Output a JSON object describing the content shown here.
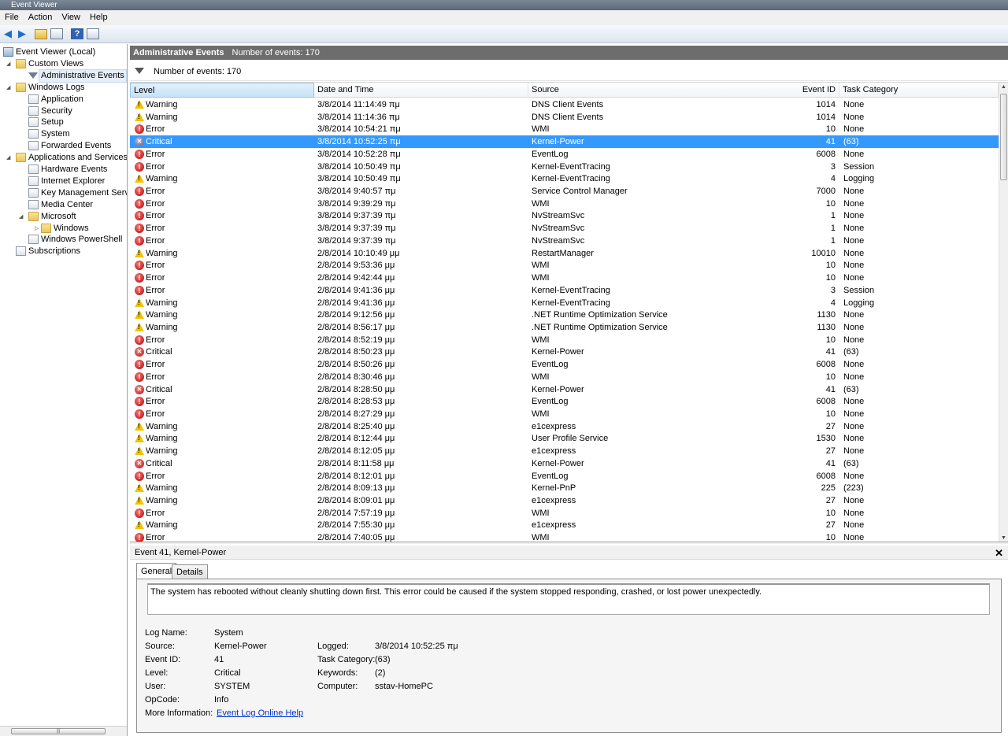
{
  "window": {
    "title": "Event Viewer"
  },
  "menu": [
    "File",
    "Action",
    "View",
    "Help"
  ],
  "tree": [
    {
      "label": "Event Viewer (Local)",
      "depth": 0,
      "icon": "computer-icon",
      "expander": ""
    },
    {
      "label": "Custom Views",
      "depth": 1,
      "icon": "folder-icon",
      "expander": "◢"
    },
    {
      "label": "Administrative Events",
      "depth": 2,
      "icon": "filter-icon",
      "expander": "",
      "selected": true
    },
    {
      "label": "Windows Logs",
      "depth": 1,
      "icon": "folder-icon",
      "expander": "◢"
    },
    {
      "label": "Application",
      "depth": 2,
      "icon": "log-icon",
      "expander": ""
    },
    {
      "label": "Security",
      "depth": 2,
      "icon": "log-icon",
      "expander": ""
    },
    {
      "label": "Setup",
      "depth": 2,
      "icon": "log-icon",
      "expander": ""
    },
    {
      "label": "System",
      "depth": 2,
      "icon": "log-icon",
      "expander": ""
    },
    {
      "label": "Forwarded Events",
      "depth": 2,
      "icon": "log-icon",
      "expander": ""
    },
    {
      "label": "Applications and Services Lo",
      "depth": 1,
      "icon": "folder-icon",
      "expander": "◢"
    },
    {
      "label": "Hardware Events",
      "depth": 2,
      "icon": "log-icon",
      "expander": ""
    },
    {
      "label": "Internet Explorer",
      "depth": 2,
      "icon": "log-icon",
      "expander": ""
    },
    {
      "label": "Key Management Service",
      "depth": 2,
      "icon": "log-icon",
      "expander": ""
    },
    {
      "label": "Media Center",
      "depth": 2,
      "icon": "log-icon",
      "expander": ""
    },
    {
      "label": "Microsoft",
      "depth": 2,
      "icon": "folder-icon",
      "expander": "◢"
    },
    {
      "label": "Windows",
      "depth": 3,
      "icon": "folder-icon",
      "expander": "▷"
    },
    {
      "label": "Windows PowerShell",
      "depth": 2,
      "icon": "log-icon",
      "expander": ""
    },
    {
      "label": "Subscriptions",
      "depth": 1,
      "icon": "log-icon",
      "expander": ""
    }
  ],
  "header": {
    "title": "Administrative Events",
    "count": "Number of events: 170"
  },
  "filter": {
    "text": "Number of events: 170"
  },
  "columns": [
    "Level",
    "Date and Time",
    "Source",
    "Event ID",
    "Task Category"
  ],
  "events": [
    {
      "level": "Warning",
      "date": "3/8/2014 11:14:49 πμ",
      "source": "DNS Client Events",
      "id": "1014",
      "task": "None"
    },
    {
      "level": "Warning",
      "date": "3/8/2014 11:14:36 πμ",
      "source": "DNS Client Events",
      "id": "1014",
      "task": "None"
    },
    {
      "level": "Error",
      "date": "3/8/2014 10:54:21 πμ",
      "source": "WMI",
      "id": "10",
      "task": "None"
    },
    {
      "level": "Critical",
      "date": "3/8/2014 10:52:25 πμ",
      "source": "Kernel-Power",
      "id": "41",
      "task": "(63)",
      "selected": true
    },
    {
      "level": "Error",
      "date": "3/8/2014 10:52:28 πμ",
      "source": "EventLog",
      "id": "6008",
      "task": "None"
    },
    {
      "level": "Error",
      "date": "3/8/2014 10:50:49 πμ",
      "source": "Kernel-EventTracing",
      "id": "3",
      "task": "Session"
    },
    {
      "level": "Warning",
      "date": "3/8/2014 10:50:49 πμ",
      "source": "Kernel-EventTracing",
      "id": "4",
      "task": "Logging"
    },
    {
      "level": "Error",
      "date": "3/8/2014 9:40:57 πμ",
      "source": "Service Control Manager",
      "id": "7000",
      "task": "None"
    },
    {
      "level": "Error",
      "date": "3/8/2014 9:39:29 πμ",
      "source": "WMI",
      "id": "10",
      "task": "None"
    },
    {
      "level": "Error",
      "date": "3/8/2014 9:37:39 πμ",
      "source": "NvStreamSvc",
      "id": "1",
      "task": "None"
    },
    {
      "level": "Error",
      "date": "3/8/2014 9:37:39 πμ",
      "source": "NvStreamSvc",
      "id": "1",
      "task": "None"
    },
    {
      "level": "Error",
      "date": "3/8/2014 9:37:39 πμ",
      "source": "NvStreamSvc",
      "id": "1",
      "task": "None"
    },
    {
      "level": "Warning",
      "date": "2/8/2014 10:10:49 μμ",
      "source": "RestartManager",
      "id": "10010",
      "task": "None"
    },
    {
      "level": "Error",
      "date": "2/8/2014 9:53:36 μμ",
      "source": "WMI",
      "id": "10",
      "task": "None"
    },
    {
      "level": "Error",
      "date": "2/8/2014 9:42:44 μμ",
      "source": "WMI",
      "id": "10",
      "task": "None"
    },
    {
      "level": "Error",
      "date": "2/8/2014 9:41:36 μμ",
      "source": "Kernel-EventTracing",
      "id": "3",
      "task": "Session"
    },
    {
      "level": "Warning",
      "date": "2/8/2014 9:41:36 μμ",
      "source": "Kernel-EventTracing",
      "id": "4",
      "task": "Logging"
    },
    {
      "level": "Warning",
      "date": "2/8/2014 9:12:56 μμ",
      "source": ".NET Runtime Optimization Service",
      "id": "1130",
      "task": "None"
    },
    {
      "level": "Warning",
      "date": "2/8/2014 8:56:17 μμ",
      "source": ".NET Runtime Optimization Service",
      "id": "1130",
      "task": "None"
    },
    {
      "level": "Error",
      "date": "2/8/2014 8:52:19 μμ",
      "source": "WMI",
      "id": "10",
      "task": "None"
    },
    {
      "level": "Critical",
      "date": "2/8/2014 8:50:23 μμ",
      "source": "Kernel-Power",
      "id": "41",
      "task": "(63)"
    },
    {
      "level": "Error",
      "date": "2/8/2014 8:50:26 μμ",
      "source": "EventLog",
      "id": "6008",
      "task": "None"
    },
    {
      "level": "Error",
      "date": "2/8/2014 8:30:46 μμ",
      "source": "WMI",
      "id": "10",
      "task": "None"
    },
    {
      "level": "Critical",
      "date": "2/8/2014 8:28:50 μμ",
      "source": "Kernel-Power",
      "id": "41",
      "task": "(63)"
    },
    {
      "level": "Error",
      "date": "2/8/2014 8:28:53 μμ",
      "source": "EventLog",
      "id": "6008",
      "task": "None"
    },
    {
      "level": "Error",
      "date": "2/8/2014 8:27:29 μμ",
      "source": "WMI",
      "id": "10",
      "task": "None"
    },
    {
      "level": "Warning",
      "date": "2/8/2014 8:25:40 μμ",
      "source": "e1cexpress",
      "id": "27",
      "task": "None"
    },
    {
      "level": "Warning",
      "date": "2/8/2014 8:12:44 μμ",
      "source": "User Profile Service",
      "id": "1530",
      "task": "None"
    },
    {
      "level": "Warning",
      "date": "2/8/2014 8:12:05 μμ",
      "source": "e1cexpress",
      "id": "27",
      "task": "None"
    },
    {
      "level": "Critical",
      "date": "2/8/2014 8:11:58 μμ",
      "source": "Kernel-Power",
      "id": "41",
      "task": "(63)"
    },
    {
      "level": "Error",
      "date": "2/8/2014 8:12:01 μμ",
      "source": "EventLog",
      "id": "6008",
      "task": "None"
    },
    {
      "level": "Warning",
      "date": "2/8/2014 8:09:13 μμ",
      "source": "Kernel-PnP",
      "id": "225",
      "task": "(223)"
    },
    {
      "level": "Warning",
      "date": "2/8/2014 8:09:01 μμ",
      "source": "e1cexpress",
      "id": "27",
      "task": "None"
    },
    {
      "level": "Error",
      "date": "2/8/2014 7:57:19 μμ",
      "source": "WMI",
      "id": "10",
      "task": "None"
    },
    {
      "level": "Warning",
      "date": "2/8/2014 7:55:30 μμ",
      "source": "e1cexpress",
      "id": "27",
      "task": "None"
    },
    {
      "level": "Error",
      "date": "2/8/2014 7:40:05 μμ",
      "source": "WMI",
      "id": "10",
      "task": "None"
    }
  ],
  "detail": {
    "title": "Event 41, Kernel-Power",
    "close": "✕",
    "tabs": [
      "General",
      "Details"
    ],
    "description": "The system has rebooted without cleanly shutting down first. This error could be caused if the system stopped responding, crashed, or lost power unexpectedly.",
    "log_name_label": "Log Name:",
    "log_name": "System",
    "source_label": "Source:",
    "source": "Kernel-Power",
    "logged_label": "Logged:",
    "logged": "3/8/2014 10:52:25 πμ",
    "event_id_label": "Event ID:",
    "event_id": "41",
    "task_label": "Task Category:",
    "task": "(63)",
    "level_label": "Level:",
    "level": "Critical",
    "keywords_label": "Keywords:",
    "keywords": "(2)",
    "user_label": "User:",
    "user": "SYSTEM",
    "computer_label": "Computer:",
    "computer": "sstav-HomePC",
    "opcode_label": "OpCode:",
    "opcode": "Info",
    "more_info_label": "More Information:",
    "more_info_link": "Event Log Online Help"
  },
  "colors": {
    "selection": "#3399ff",
    "header_bg": "#6d6d6d"
  }
}
